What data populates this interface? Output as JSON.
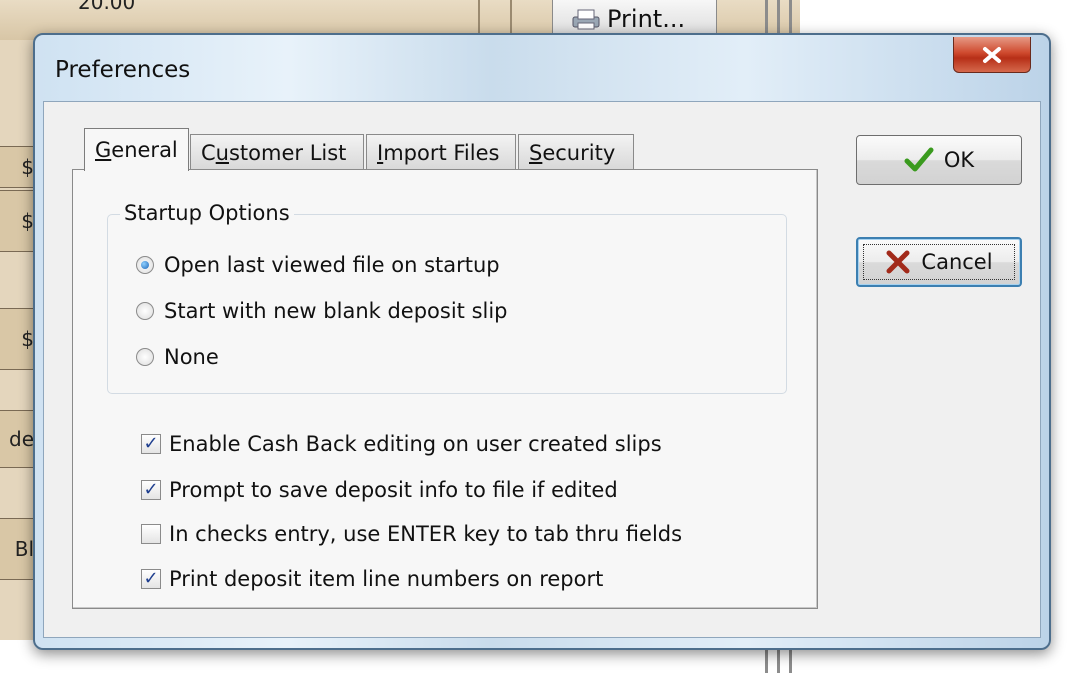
{
  "background": {
    "print_button_label": "Print...",
    "partial_top_text": "20.00",
    "left_fragments": [
      "$",
      "$",
      "$",
      "de",
      "Bl"
    ]
  },
  "dialog": {
    "title": "Preferences",
    "close_icon": "close-x-icon",
    "tabs": [
      {
        "label": "General",
        "mnemonic_index": 0,
        "active": true
      },
      {
        "label": "Customer List",
        "mnemonic_index": 1,
        "active": false
      },
      {
        "label": "Import Files",
        "mnemonic_index": 0,
        "active": false
      },
      {
        "label": "Security",
        "mnemonic_index": 0,
        "active": false
      }
    ],
    "startup": {
      "legend": "Startup Options",
      "options": [
        {
          "label": "Open last viewed file on startup",
          "selected": true
        },
        {
          "label": "Start with new blank deposit slip",
          "selected": false
        },
        {
          "label": "None",
          "selected": false
        }
      ]
    },
    "checkboxes": [
      {
        "label": "Enable Cash Back editing on user created slips",
        "checked": true
      },
      {
        "label": "Prompt to save deposit info to file if edited",
        "checked": true
      },
      {
        "label": "In checks entry, use ENTER key to tab thru fields",
        "checked": false
      },
      {
        "label": "Print deposit item line numbers on report",
        "checked": true
      }
    ],
    "buttons": {
      "ok_label": "OK",
      "cancel_label": "Cancel"
    }
  },
  "colors": {
    "ok_check": "#3a9a1e",
    "cancel_x": "#a22a1a",
    "close_button": "#c94a2e"
  }
}
